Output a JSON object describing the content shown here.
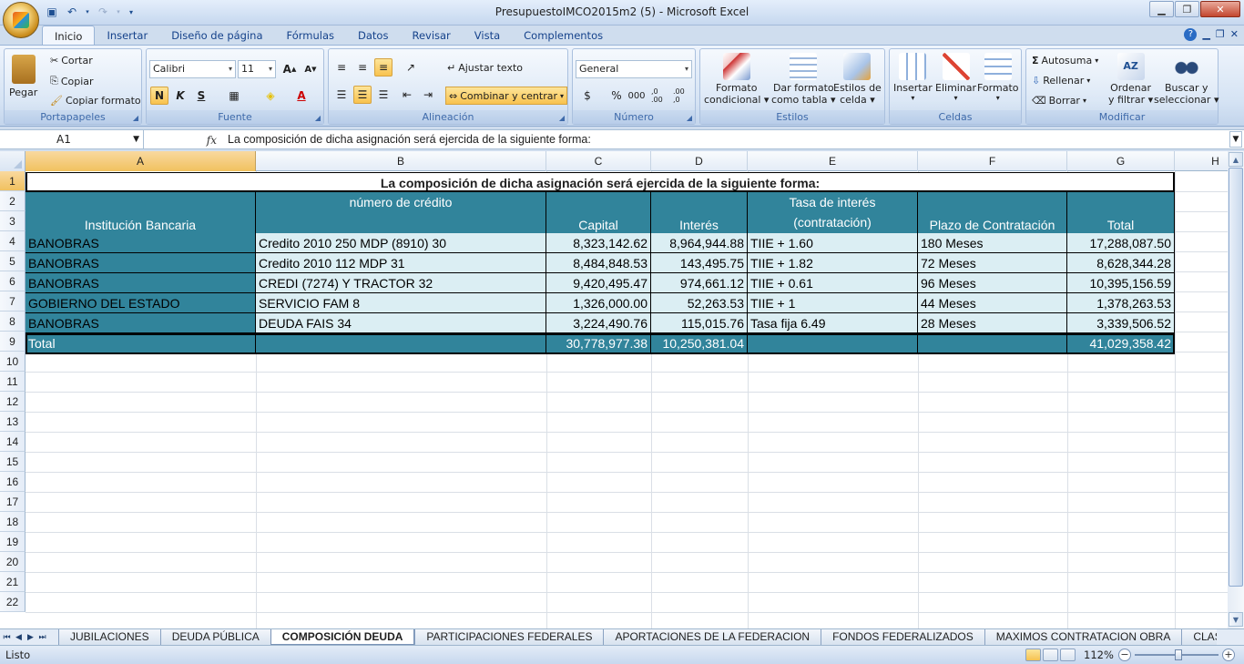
{
  "window": {
    "title": "PresupuestoIMCO2015m2 (5) - Microsoft Excel"
  },
  "menu": {
    "tabs": [
      "Inicio",
      "Insertar",
      "Diseño de página",
      "Fórmulas",
      "Datos",
      "Revisar",
      "Vista",
      "Complementos"
    ]
  },
  "ribbon": {
    "clipboard": {
      "label": "Portapapeles",
      "paste": "Pegar",
      "cut": "Cortar",
      "copy": "Copiar",
      "format_painter": "Copiar formato"
    },
    "font": {
      "label": "Fuente",
      "name": "Calibri",
      "size": "11",
      "bold": "N",
      "italic": "K",
      "underline": "S"
    },
    "alignment": {
      "label": "Alineación",
      "wrap": "Ajustar texto",
      "merge": "Combinar y centrar"
    },
    "number": {
      "label": "Número",
      "format": "General",
      "currency": "$",
      "percent": "%",
      "thousands": "000",
      "inc_dec": ",0 .00",
      "dec_dec": ".00 ,0"
    },
    "styles": {
      "label": "Estilos",
      "cond1": "Formato",
      "cond2": "condicional",
      "table1": "Dar formato",
      "table2": "como tabla",
      "cell1": "Estilos de",
      "cell2": "celda"
    },
    "cells": {
      "label": "Celdas",
      "insert": "Insertar",
      "delete": "Eliminar",
      "format": "Formato"
    },
    "edit": {
      "label": "Modificar",
      "autosum": "Autosuma",
      "fill": "Rellenar",
      "clear": "Borrar",
      "sort1": "Ordenar",
      "sort2": "y filtrar",
      "find1": "Buscar y",
      "find2": "seleccionar"
    }
  },
  "formula_bar": {
    "name_box": "A1",
    "fx": "fx",
    "content": "La composición de dicha asignación será ejercida de la siguiente forma:"
  },
  "columns": [
    "A",
    "B",
    "C",
    "D",
    "E",
    "F",
    "G",
    "H"
  ],
  "rows": [
    "1",
    "2",
    "3",
    "4",
    "5",
    "6",
    "7",
    "8",
    "9",
    "10",
    "11",
    "12",
    "13",
    "14",
    "15",
    "16",
    "17",
    "18",
    "19",
    "20",
    "21",
    "22"
  ],
  "sheet": {
    "title": "La composición de dicha asignación será ejercida de la siguiente forma:",
    "headers": {
      "institucion": "Institución Bancaria",
      "credito": "número de crédito",
      "capital": "Capital",
      "interes": "Interés",
      "tasa1": "Tasa de interés",
      "tasa2": "(contratación)",
      "plazo": "Plazo de Contratación",
      "total": "Total"
    },
    "data": [
      [
        "BANOBRAS",
        "Credito 2010 250 MDP (8910) 30",
        "8,323,142.62",
        "8,964,944.88",
        "TIIE + 1.60",
        "180 Meses",
        "17,288,087.50"
      ],
      [
        "BANOBRAS",
        "Credito 2010 112 MDP  31",
        "8,484,848.53",
        "143,495.75",
        "TIIE + 1.82",
        "72 Meses",
        "8,628,344.28"
      ],
      [
        "BANOBRAS",
        "CREDI (7274) Y TRACTOR 32",
        "9,420,495.47",
        "974,661.12",
        "TIIE + 0.61",
        "96 Meses",
        "10,395,156.59"
      ],
      [
        "GOBIERNO DEL ESTADO",
        "SERVICIO FAM 8",
        "1,326,000.00",
        "52,263.53",
        "TIIE + 1",
        "44 Meses",
        "1,378,263.53"
      ],
      [
        "BANOBRAS",
        "DEUDA FAIS 34",
        "3,224,490.76",
        "115,015.76",
        "Tasa fija 6.49",
        "28 Meses",
        "3,339,506.52"
      ]
    ],
    "total_row": [
      "Total",
      "",
      "30,778,977.38",
      "10,250,381.04",
      "",
      "",
      "41,029,358.42"
    ]
  },
  "sheet_tabs": [
    "JUBILACIONES",
    "DEUDA PÚBLICA",
    "COMPOSICIÓN DEUDA",
    "PARTICIPACIONES FEDERALES",
    "APORTACIONES DE LA FEDERACION",
    "FONDOS FEDERALIZADOS",
    "MAXIMOS CONTRATACION OBRA",
    "CLASIFIC."
  ],
  "status": {
    "text": "Listo",
    "zoom": "112%"
  },
  "colors": {
    "teal": "#31849b",
    "light": "#dbeef3",
    "selected_header": "#f1c15f"
  }
}
